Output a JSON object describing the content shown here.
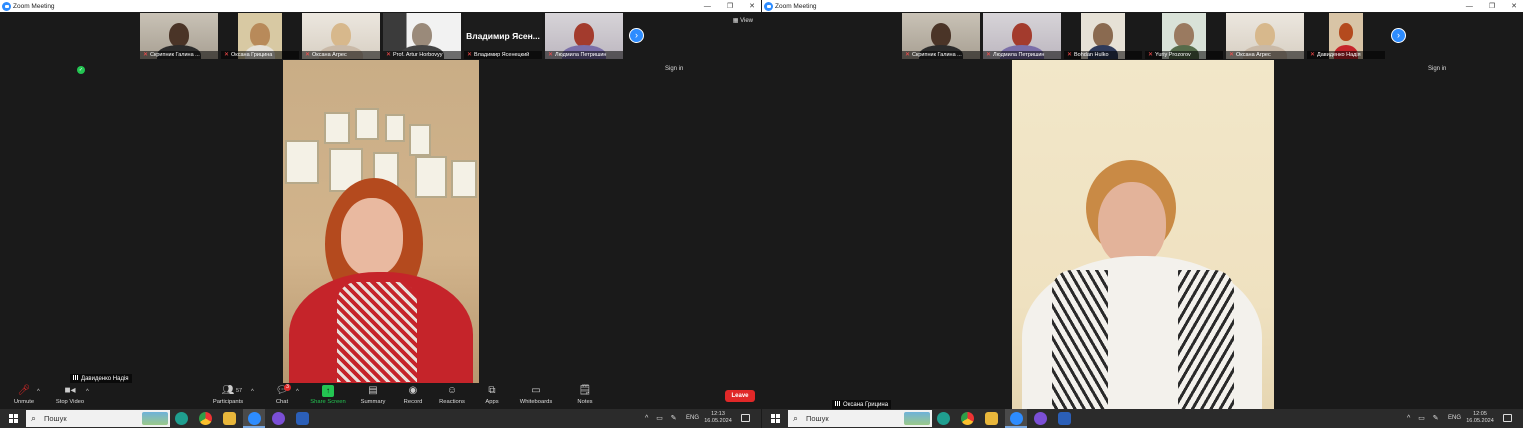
{
  "left": {
    "window_title": "Zoom Meeting",
    "gallery": [
      {
        "name": "Скрипник Галина ..."
      },
      {
        "name": "Оксана Грицина"
      },
      {
        "name": "Оксана Агрес"
      },
      {
        "name": "Prof. Artur Horbovyy"
      },
      {
        "name": "Владимир Ясенецкий",
        "big_label": "Владимир  Ясен..."
      },
      {
        "name": "Людмила Петришин"
      }
    ],
    "view_label": "View",
    "sign_in": "Sign in",
    "speaker_name": "Давиденко Надія",
    "toolbar": {
      "unmute": "Unmute",
      "stop_video": "Stop Video",
      "participants": "Participants",
      "participants_count": "57",
      "chat": "Chat",
      "chat_badge": "3",
      "share_screen": "Share Screen",
      "summary": "Summary",
      "record": "Record",
      "reactions": "Reactions",
      "apps": "Apps",
      "whiteboards": "Whiteboards",
      "notes": "Notes",
      "leave": "Leave"
    },
    "taskbar": {
      "search_placeholder": "Пошук",
      "lang": "ENG",
      "time": "12:13",
      "date": "16.05.2024"
    }
  },
  "right": {
    "window_title": "Zoom Meeting",
    "gallery": [
      {
        "name": "Скрипник Галина ..."
      },
      {
        "name": "Людмила Петришин"
      },
      {
        "name": "Bohdan Hulko"
      },
      {
        "name": "Yuriy Prozorov"
      },
      {
        "name": "Оксана Агрес"
      },
      {
        "name": "Давиденко Надія"
      }
    ],
    "sign_in": "Sign in",
    "speaker_name": "Оксана Грицина",
    "taskbar": {
      "search_placeholder": "Пошук",
      "lang": "ENG",
      "time": "12:05",
      "date": "16.05.2024"
    }
  },
  "colors": {
    "zoom_blue": "#2d8cff",
    "leave_red": "#e02828",
    "share_green": "#23c552",
    "background": "#1a1a1a"
  },
  "icons": [
    "zoom-logo-icon",
    "minimize-icon",
    "restore-icon",
    "close-icon",
    "next-page-icon",
    "shield-icon",
    "mic-muted-icon",
    "video-icon",
    "participants-icon",
    "chat-icon",
    "share-screen-icon",
    "summary-icon",
    "record-icon",
    "reactions-icon",
    "apps-icon",
    "whiteboards-icon",
    "notes-icon",
    "windows-start-icon",
    "search-icon",
    "signal-icon"
  ]
}
